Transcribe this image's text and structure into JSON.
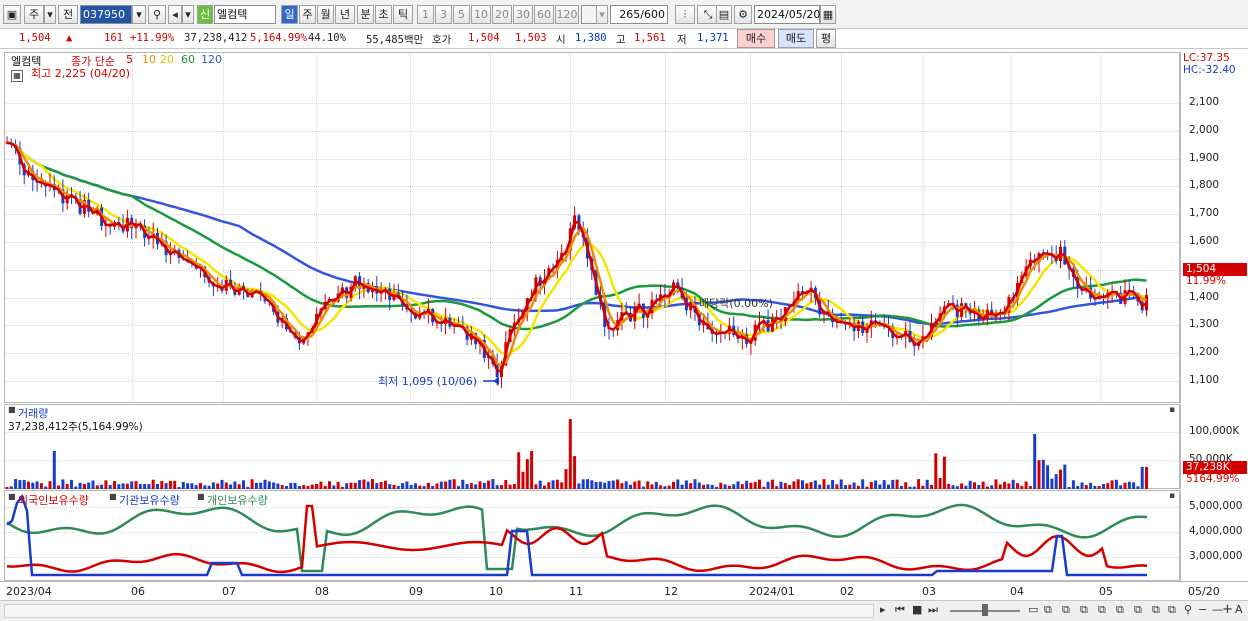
{
  "toolbar": {
    "period": "주",
    "prev": "전",
    "code": "037950",
    "badge": "신",
    "name": "엘컴텍",
    "tf": [
      "일",
      "주",
      "월",
      "년",
      "분",
      "초",
      "틱"
    ],
    "mins": [
      "1",
      "3",
      "5",
      "10",
      "20",
      "30",
      "60",
      "120"
    ],
    "count": "265",
    "count_total": "/600",
    "date": "2024/05/20"
  },
  "info": {
    "price": "1,504",
    "change": "161",
    "change_pct": "+11.99%",
    "volume": "37,238,412",
    "vol_ratio": "5,164.99%",
    "turnover": "44.10%",
    "amount": "55,485백만",
    "ask_label": "호가",
    "ask": "1,504",
    "bid": "1,503",
    "open_label": "시",
    "open": "1,380",
    "high_label": "고",
    "high": "1,561",
    "low_label": "저",
    "low": "1,371",
    "buy": "매수",
    "sell": "매도",
    "eval": "평"
  },
  "price_panel": {
    "stock": "엘컴텍",
    "ma_label": "종가 단순",
    "ma_periods": [
      "5",
      "10",
      "20",
      "60",
      "120"
    ],
    "high_note": "최고 2,225 (04/20)",
    "low_note": "최저 1,095 (10/06)",
    "ex_div": "배당락(0.00%)",
    "lc": "LC:37.35",
    "hc": "HC:-32.40",
    "last_price": "1,504",
    "last_pct": "11.99%",
    "ticks": [
      "2,100",
      "2,000",
      "1,900",
      "1,800",
      "1,700",
      "1,600",
      "1,400",
      "1,300",
      "1,200",
      "1,100"
    ]
  },
  "volume_panel": {
    "title": "거래량",
    "value": "37,238,412주(5,164.99%)",
    "ticks": [
      "100,000K",
      "50,000K"
    ],
    "last": "37,238K",
    "last_pct": "5164.99%"
  },
  "holder_panel": {
    "s1": "외국인보유수량",
    "s2": "기관보유수량",
    "s3": "개인보유수량",
    "ticks": [
      "5,000,000",
      "4,000,000",
      "3,000,000"
    ]
  },
  "xaxis": [
    "2023/04",
    "06",
    "07",
    "08",
    "09",
    "10",
    "11",
    "12",
    "2024/01",
    "02",
    "03",
    "04",
    "05"
  ],
  "xaxis_right": "05/20",
  "colors": {
    "up": "#d40000",
    "down": "#1a3ccc",
    "ma5": "#d40000",
    "ma10": "#f08c00",
    "ma20": "#f5e600",
    "ma60": "#1a9a3a",
    "ma120": "#3355dd"
  }
}
